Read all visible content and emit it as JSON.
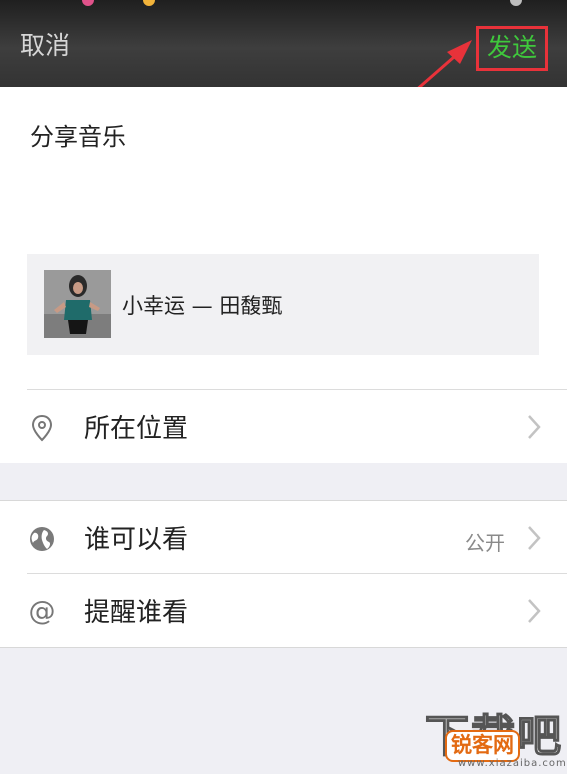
{
  "header": {
    "cancel_label": "取消",
    "send_label": "发送"
  },
  "compose": {
    "share_text": "分享音乐",
    "music": {
      "title": "小幸运 — 田馥甄",
      "cover_icon": "album-cover-image"
    }
  },
  "location_row": {
    "label": "所在位置",
    "icon": "location-pin-icon"
  },
  "privacy": {
    "who_can_see": {
      "label": "谁可以看",
      "value": "公开",
      "icon": "globe-icon"
    },
    "remind": {
      "label": "提醒谁看",
      "icon": "at-sign-icon"
    }
  },
  "watermark": {
    "big": "下载吧",
    "badge": "锐客网",
    "url": "www.xiazaiba.com"
  },
  "colors": {
    "accent_green": "#3fc83c",
    "highlight_red": "#e8323a",
    "topbar_dark": "#333333"
  }
}
